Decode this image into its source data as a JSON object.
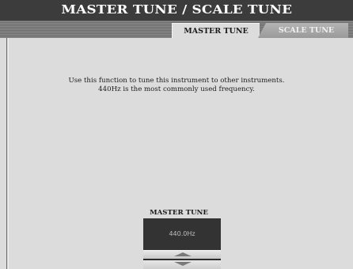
{
  "header": {
    "title": "MASTER TUNE / SCALE TUNE"
  },
  "tabs": [
    {
      "label": "MASTER TUNE",
      "active": true
    },
    {
      "label": "SCALE TUNE",
      "active": false
    }
  ],
  "main": {
    "description_line1": "Use this function to tune this instrument to other instruments.",
    "description_line2": "440Hz is the most commonly used frequency."
  },
  "control": {
    "label": "MASTER TUNE",
    "value": "440.0Hz",
    "up_icon": "triangle-up-icon",
    "down_icon": "triangle-down-icon"
  },
  "colors": {
    "title_bar": "#3c3c3c",
    "panel": "#dcdcdc",
    "value_box": "#333333",
    "inactive_tab": "#a8a8a8"
  }
}
